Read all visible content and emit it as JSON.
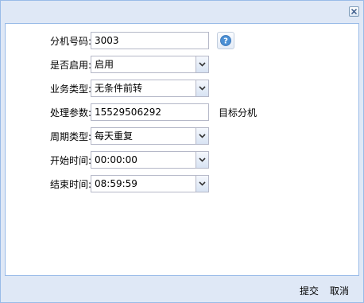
{
  "dialog": {
    "close_icon": "close-icon"
  },
  "form": {
    "extension": {
      "label": "分机号码:",
      "value": "3003",
      "help_icon": "question-icon"
    },
    "enabled": {
      "label": "是否启用:",
      "value": "启用"
    },
    "business_type": {
      "label": "业务类型:",
      "value": "无条件前转"
    },
    "params": {
      "label": "处理参数:",
      "value": "15529506292",
      "suffix": "目标分机"
    },
    "cycle_type": {
      "label": "周期类型:",
      "value": "每天重复"
    },
    "start_time": {
      "label": "开始时间:",
      "value": "00:00:00"
    },
    "end_time": {
      "label": "结束时间:",
      "value": "08:59:59"
    }
  },
  "footer": {
    "submit_label": "提交",
    "cancel_label": "取消"
  },
  "colors": {
    "frame": "#dfe8f6",
    "border": "#99bbe8",
    "field_border": "#b5b8c8",
    "help_icon": "#4a8fd4"
  }
}
